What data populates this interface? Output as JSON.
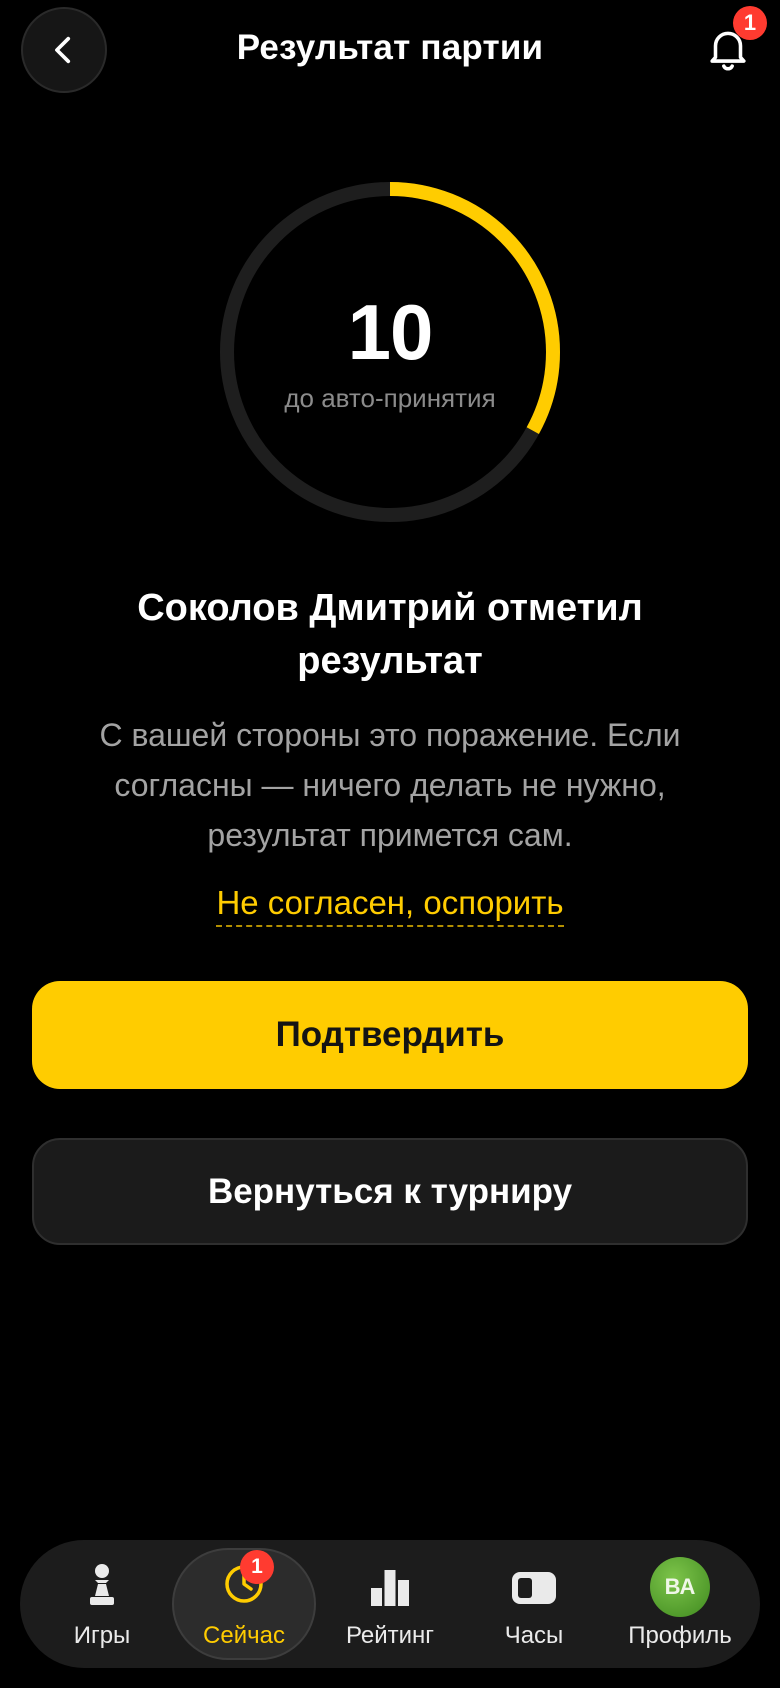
{
  "header": {
    "title": "Результат партии",
    "notifications_count": "1"
  },
  "timer": {
    "seconds": "10",
    "caption": "до авто-принятия",
    "progress_fraction": 0.33,
    "progress_color": "#ffcc00",
    "track_color": "#1e1e1e"
  },
  "message": {
    "headline": "Соколов Дмитрий отметил результат",
    "body": "С вашей стороны это поражение. Если согласны — ничего делать не нужно, результат примется сам.",
    "dispute_link": "Не согласен, оспорить"
  },
  "actions": {
    "confirm_label": "Подтвердить",
    "return_label": "Вернуться к турниру"
  },
  "tabbar": {
    "items": [
      {
        "label": "Игры",
        "icon": "pawn-icon"
      },
      {
        "label": "Сейчас",
        "icon": "clock-icon",
        "badge": "1",
        "active": true
      },
      {
        "label": "Рейтинг",
        "icon": "bar-chart-icon"
      },
      {
        "label": "Часы",
        "icon": "chess-clock-icon"
      },
      {
        "label": "Профиль",
        "icon": "avatar",
        "avatar_initials": "ВА"
      }
    ]
  },
  "colors": {
    "accent": "#ffcc00",
    "badge": "#ff3b30",
    "background": "#000000"
  }
}
